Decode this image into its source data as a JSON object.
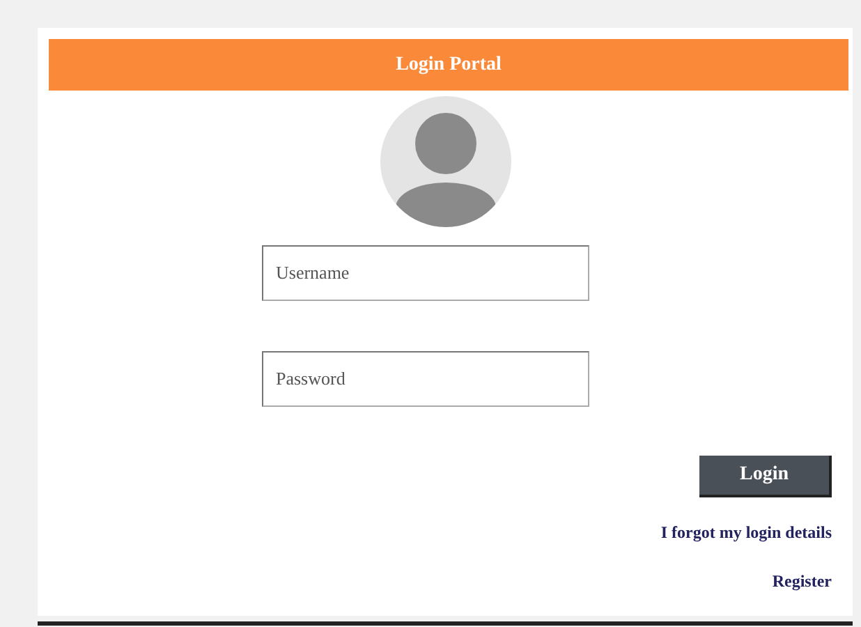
{
  "header": {
    "title": "Login Portal"
  },
  "fields": [
    {
      "placeholder": "Username"
    },
    {
      "placeholder": "Password"
    }
  ],
  "button": {
    "label": "Login"
  },
  "links": [
    "I forgot my login details",
    "Register"
  ]
}
